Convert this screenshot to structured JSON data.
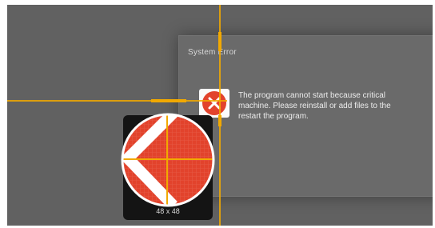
{
  "dialog": {
    "title": "System Error",
    "message": "The program cannot start because critical\nmachine. Please reinstall or add files to the\nrestart the program."
  },
  "magnifier": {
    "size_readout": "48 x 48",
    "icon": "error-x-icon",
    "zoom_icon": "magnified-error-icon"
  },
  "colors": {
    "desktop": "#616161",
    "dialog": "#6a6a6a",
    "crosshair": "#f2a900",
    "error_red": "#e2432c"
  }
}
